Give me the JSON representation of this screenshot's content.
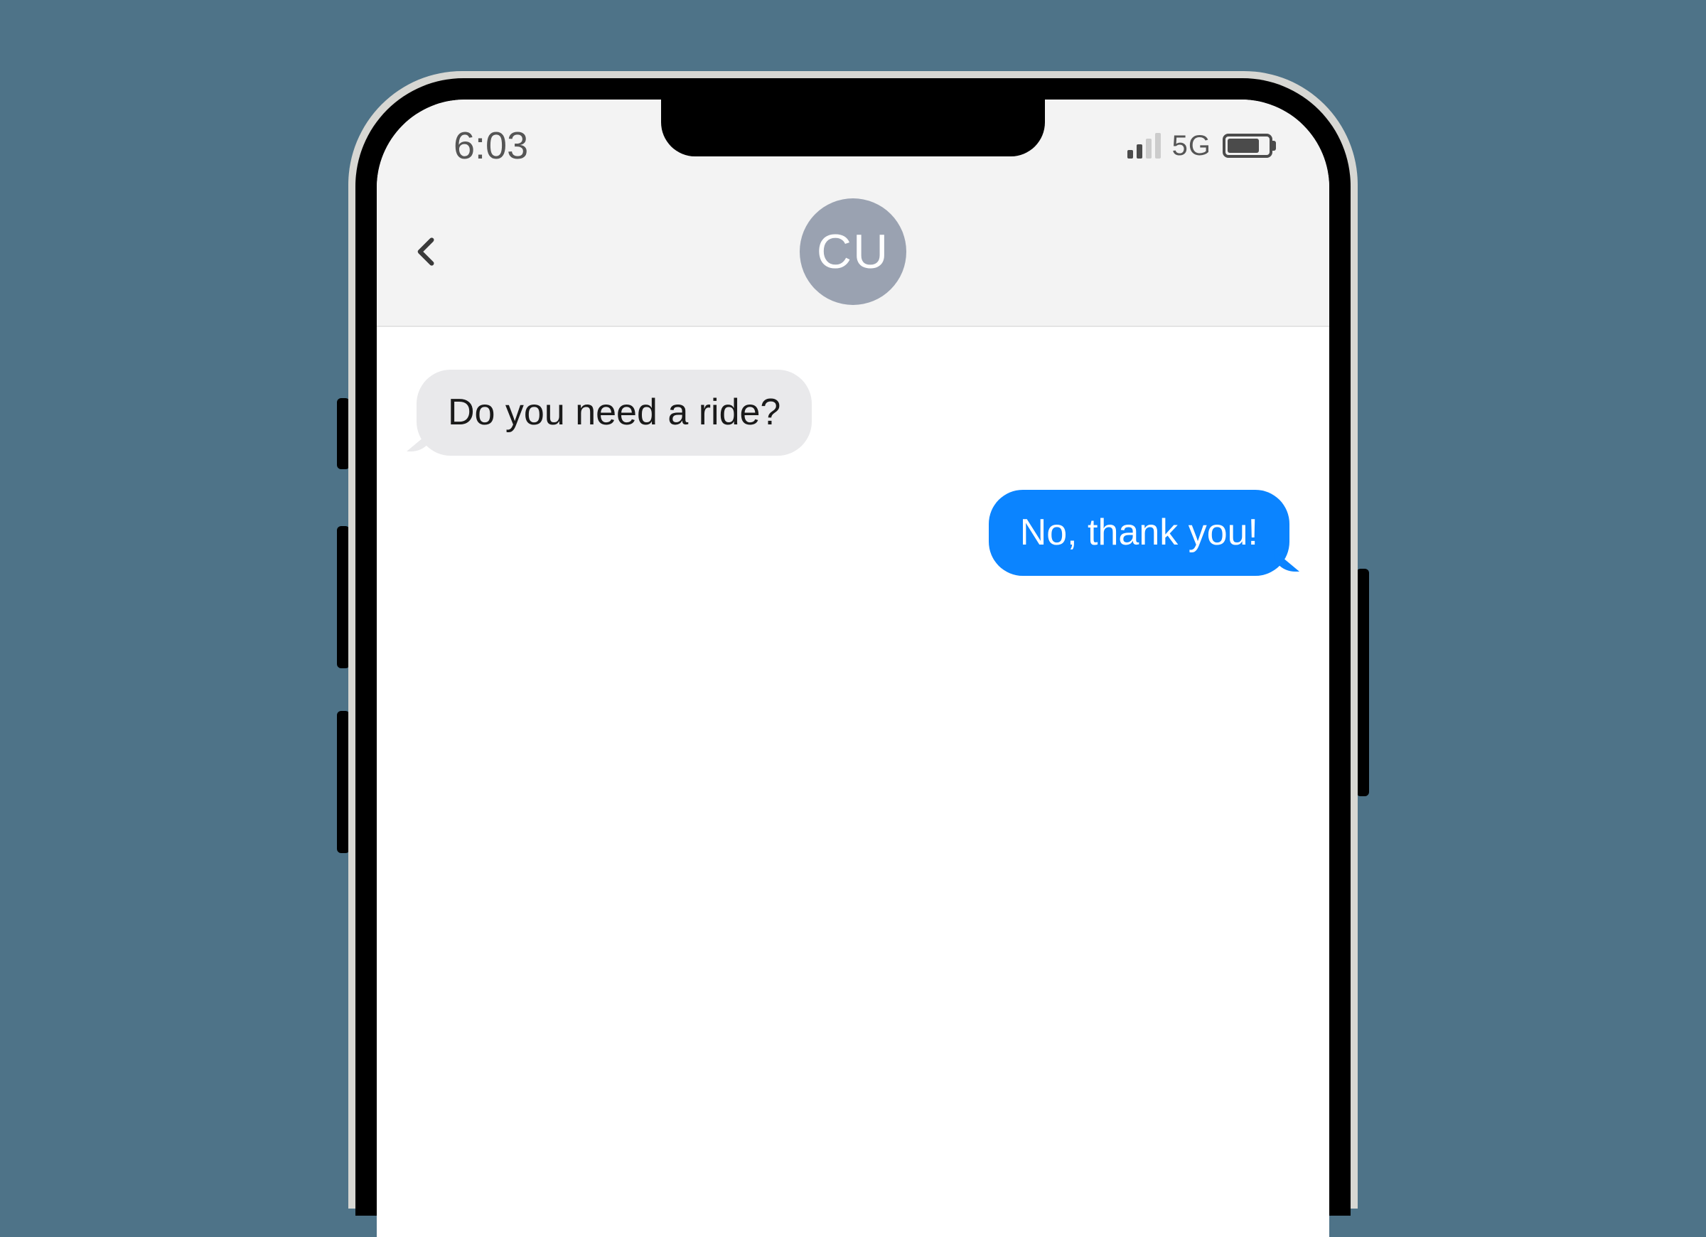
{
  "status": {
    "time": "6:03",
    "network": "5G",
    "signal_bars_active": 2,
    "battery_percent": 78
  },
  "header": {
    "avatar_initials": "CU"
  },
  "messages": {
    "incoming_1": "Do you need a ride?",
    "outgoing_1": "No, thank you!"
  },
  "colors": {
    "background": "#4e7388",
    "bubble_out": "#0b84ff",
    "bubble_in": "#e9e9eb",
    "avatar": "#9aa2b1"
  }
}
